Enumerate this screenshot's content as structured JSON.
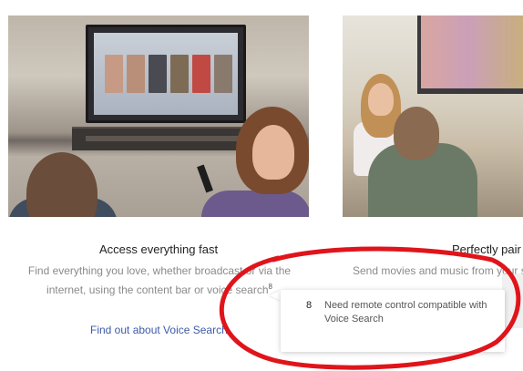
{
  "features": [
    {
      "title": "Access everything fast",
      "body_line1": "Find everything you love, whether broadcast or via the",
      "body_line2": "internet, using the content bar or voice search",
      "footnote_mark": "8",
      "link": "Find out about Voice Search"
    },
    {
      "title": "Perfectly pair",
      "body_line1": "Send movies and music from your s"
    }
  ],
  "tooltip": {
    "number": "8",
    "text": "Need remote control compatible with Voice Search"
  },
  "colors": {
    "link": "#3d5ba9",
    "annotation_ring": "#e0141b"
  }
}
